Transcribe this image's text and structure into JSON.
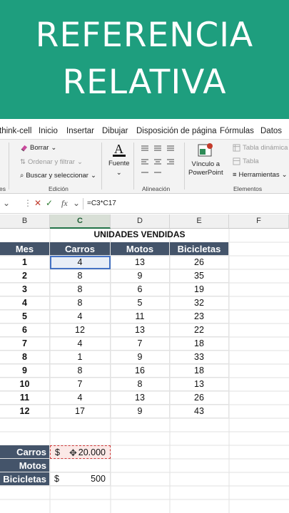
{
  "banner": {
    "line1": "REFERENCIA",
    "line2": "RELATIVA"
  },
  "ribbon_tabs": [
    "think-cell",
    "Inicio",
    "Insertar",
    "Dibujar",
    "Disposición de página",
    "Fórmulas",
    "Datos"
  ],
  "ribbon": {
    "borrar": "Borrar",
    "ordenar": "Ordenar y filtrar",
    "buscar": "Buscar y seleccionar",
    "fuente": "Fuente",
    "vinculo_line1": "Vínculo a",
    "vinculo_line2": "PowerPoint",
    "tabla_dinamica": "Tabla dinámica",
    "tabla": "Tabla",
    "herramientas": "Herramientas",
    "group_es": "es",
    "group_edicion": "Edición",
    "group_alineacion": "Alineación",
    "group_elementos": "Elementos"
  },
  "formula_bar": {
    "fx": "fx",
    "formula": "=C3*C17"
  },
  "columns": [
    "B",
    "C",
    "D",
    "E",
    "F"
  ],
  "sheet": {
    "title": "UNIDADES VENDIDAS",
    "headers": [
      "Mes",
      "Carros",
      "Motos",
      "Bicicletas"
    ],
    "rows": [
      [
        "1",
        "4",
        "13",
        "26"
      ],
      [
        "2",
        "8",
        "9",
        "35"
      ],
      [
        "3",
        "8",
        "6",
        "19"
      ],
      [
        "4",
        "8",
        "5",
        "32"
      ],
      [
        "5",
        "4",
        "11",
        "23"
      ],
      [
        "6",
        "12",
        "13",
        "22"
      ],
      [
        "7",
        "4",
        "7",
        "18"
      ],
      [
        "8",
        "1",
        "9",
        "33"
      ],
      [
        "9",
        "8",
        "16",
        "18"
      ],
      [
        "10",
        "7",
        "8",
        "13"
      ],
      [
        "11",
        "4",
        "13",
        "26"
      ],
      [
        "12",
        "17",
        "9",
        "43"
      ]
    ],
    "summary": [
      {
        "label": "Carros",
        "currency": "$",
        "value": "20.000"
      },
      {
        "label": "Motos",
        "currency": "",
        "value": ""
      },
      {
        "label": "Bicicletas",
        "currency": "$",
        "value": "500"
      }
    ]
  },
  "colors": {
    "banner": "#1e9e7e",
    "header_fill": "#44546a",
    "selection": "#4472c4"
  }
}
